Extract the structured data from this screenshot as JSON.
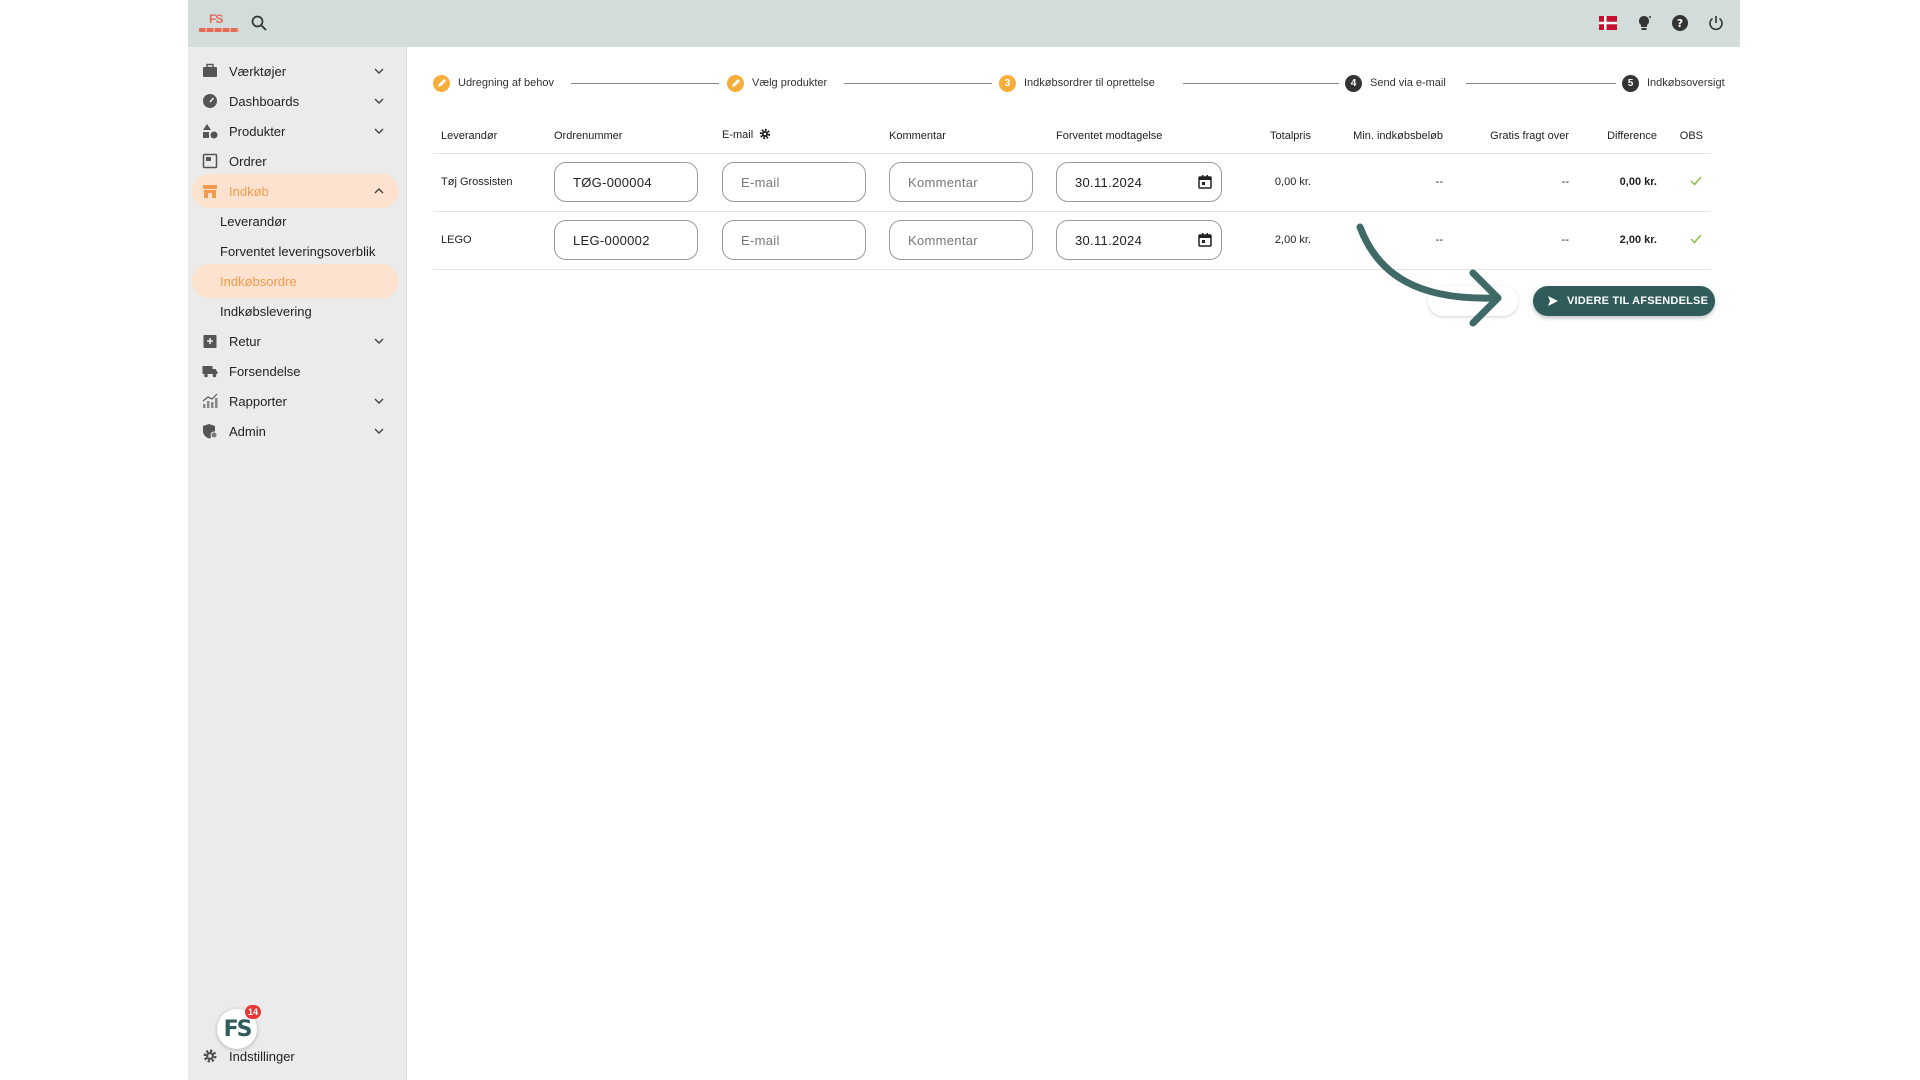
{
  "topbar": {
    "logo_icon": "peak-systems-logo",
    "search_icon": "search-icon",
    "right_icons": [
      "danish-flag-icon",
      "lightbulb-icon",
      "help-icon",
      "power-icon"
    ]
  },
  "sidebar": {
    "items": [
      {
        "label": "Værktøjer",
        "icon": "toolbox-icon",
        "chevron": "down"
      },
      {
        "label": "Dashboards",
        "icon": "gauge-icon",
        "chevron": "down"
      },
      {
        "label": "Produkter",
        "icon": "shapes-icon",
        "chevron": "down"
      },
      {
        "label": "Ordrer",
        "icon": "orders-icon",
        "chevron": ""
      },
      {
        "label": "Indkøb",
        "icon": "store-icon",
        "chevron": "up",
        "active": true
      }
    ],
    "sub_items": [
      {
        "label": "Leverandør"
      },
      {
        "label": "Forventet leveringsoverblik"
      },
      {
        "label": "Indkøbsordre",
        "active": true
      },
      {
        "label": "Indkøbslevering"
      }
    ],
    "items_after": [
      {
        "label": "Retur",
        "icon": "return-icon",
        "chevron": "down"
      },
      {
        "label": "Forsendelse",
        "icon": "truck-icon",
        "chevron": ""
      },
      {
        "label": "Rapporter",
        "icon": "chart-icon",
        "chevron": "down"
      },
      {
        "label": "Admin",
        "icon": "admin-icon",
        "chevron": "down"
      }
    ],
    "badge": {
      "text": "FS",
      "count": "14"
    },
    "settings_label": "Indstillinger"
  },
  "stepper": {
    "steps": [
      {
        "label": "Udregning af behov",
        "state": "done",
        "num": ""
      },
      {
        "label": "Vælg produkter",
        "state": "done",
        "num": ""
      },
      {
        "label": "Indkøbsordrer til oprettelse",
        "state": "current",
        "num": "3"
      },
      {
        "label": "Send via e-mail",
        "state": "todo",
        "num": "4"
      },
      {
        "label": "Indkøbsoversigt",
        "state": "todo",
        "num": "5"
      }
    ]
  },
  "table": {
    "headers": {
      "supplier": "Leverandør",
      "order_number": "Ordrenummer",
      "email": "E-mail",
      "comment": "Kommentar",
      "expected": "Forventet modtagelse",
      "total": "Totalpris",
      "min": "Min. indkøbsbeløb",
      "free_freight": "Gratis fragt over",
      "difference": "Difference",
      "obs": "OBS"
    },
    "rows": [
      {
        "supplier": "Tøj Grossisten",
        "order_number": "TØG-000004",
        "email_placeholder": "E-mail",
        "comment_placeholder": "Kommentar",
        "date": "30.11.2024",
        "total": "0,00 kr.",
        "min": "--",
        "free_freight": "--",
        "difference": "0,00 kr."
      },
      {
        "supplier": "LEGO",
        "order_number": "LEG-000002",
        "email_placeholder": "E-mail",
        "comment_placeholder": "Kommentar",
        "date": "30.11.2024",
        "total": "2,00 kr.",
        "min": "--",
        "free_freight": "--",
        "difference": "2,00 kr."
      }
    ]
  },
  "actions": {
    "primary_label": "VIDERE TIL AFSENDELSE"
  },
  "colors": {
    "accent": "#f29b4c",
    "primary": "#2f5b5a",
    "success": "#8bc34a"
  }
}
